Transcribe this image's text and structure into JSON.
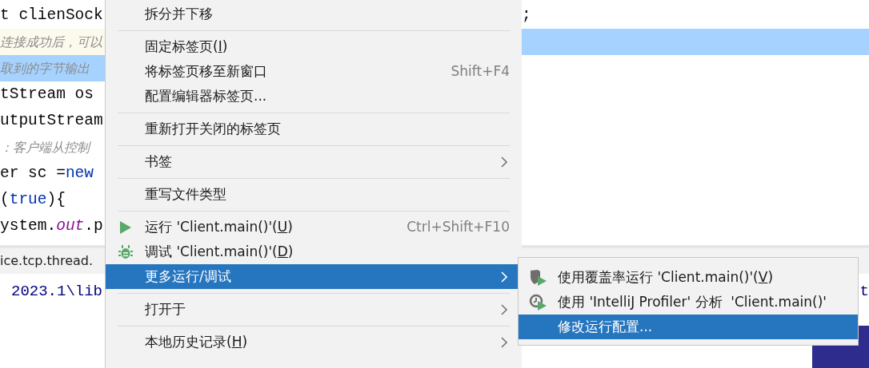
{
  "editor": {
    "left_lines": [
      {
        "selected": false,
        "caret_line": false,
        "tokens": [
          {
            "kind": "plain",
            "text": "t clienSock"
          }
        ]
      },
      {
        "selected": false,
        "caret_line": true,
        "tokens": [
          {
            "kind": "comment",
            "text": "连接成功后，可以"
          }
        ]
      },
      {
        "selected": true,
        "caret_line": false,
        "tokens": [
          {
            "kind": "comment",
            "text": "取到的字节输出"
          }
        ]
      },
      {
        "selected": false,
        "caret_line": false,
        "tokens": [
          {
            "kind": "plain",
            "text": "tStream os"
          }
        ]
      },
      {
        "selected": false,
        "caret_line": false,
        "tokens": [
          {
            "kind": "plain",
            "text": "utputStream"
          }
        ]
      },
      {
        "selected": false,
        "caret_line": false,
        "tokens": [
          {
            "kind": "comment",
            "text": "：客户端从控制"
          }
        ]
      },
      {
        "selected": false,
        "caret_line": false,
        "tokens": [
          {
            "kind": "plain",
            "text": "er sc ="
          },
          {
            "kind": "keyword",
            "text": "new"
          }
        ]
      },
      {
        "selected": false,
        "caret_line": false,
        "tokens": [
          {
            "kind": "plain",
            "text": "("
          },
          {
            "kind": "keyword",
            "text": "true"
          },
          {
            "kind": "plain",
            "text": "){"
          }
        ]
      },
      {
        "selected": false,
        "caret_line": false,
        "tokens": [
          {
            "kind": "plain",
            "text": "ystem."
          },
          {
            "kind": "field",
            "text": "out"
          },
          {
            "kind": "plain",
            "text": ".p"
          }
        ]
      }
    ],
    "right_lines": [
      {
        "selected": false,
        "tokens": [
          {
            "kind": "plain",
            "text": ";"
          }
        ]
      },
      {
        "selected": true
      }
    ]
  },
  "tool_window": {
    "title": "ice.tcp.thread.",
    "console_text": "2023.1\\lib",
    "console_text_right": "t"
  },
  "context_menu": {
    "items": [
      {
        "kind": "item",
        "label": "拆分并下移",
        "selected": false
      },
      {
        "kind": "separator"
      },
      {
        "kind": "item",
        "label": "固定标签页(",
        "mnemonic": "I",
        "label_end": ")",
        "selected": false
      },
      {
        "kind": "item",
        "label": "将标签页移至新窗口",
        "shortcut": "Shift+F4",
        "selected": false
      },
      {
        "kind": "item",
        "label": "配置编辑器标签页...",
        "selected": false
      },
      {
        "kind": "separator"
      },
      {
        "kind": "item",
        "label": "重新打开关闭的标签页",
        "selected": false
      },
      {
        "kind": "separator"
      },
      {
        "kind": "submenu",
        "label": "书签",
        "selected": false
      },
      {
        "kind": "separator"
      },
      {
        "kind": "item",
        "label": "重写文件类型",
        "selected": false
      },
      {
        "kind": "separator"
      },
      {
        "kind": "run",
        "label": "运行 'Client.main()'(",
        "mnemonic": "U",
        "label_end": ")",
        "shortcut": "Ctrl+Shift+F10",
        "selected": false
      },
      {
        "kind": "debug",
        "label": "调试 'Client.main()'(",
        "mnemonic": "D",
        "label_end": ")",
        "selected": false
      },
      {
        "kind": "submenu",
        "label": "更多运行/调试",
        "selected": true
      },
      {
        "kind": "separator"
      },
      {
        "kind": "submenu",
        "label": "打开于",
        "selected": false
      },
      {
        "kind": "separator"
      },
      {
        "kind": "submenu",
        "label": "本地历史记录(",
        "mnemonic": "H",
        "label_end": ")",
        "selected": false
      }
    ]
  },
  "submenu": {
    "items": [
      {
        "kind": "coverage",
        "label": "使用覆盖率运行 'Client.main()'(",
        "mnemonic": "V",
        "label_end": ")",
        "selected": false
      },
      {
        "kind": "profiler",
        "label": "使用 'IntelliJ Profiler' 分析  'Client.main()'",
        "selected": false
      },
      {
        "kind": "item",
        "label": "修改运行配置...",
        "selected": true
      }
    ]
  }
}
